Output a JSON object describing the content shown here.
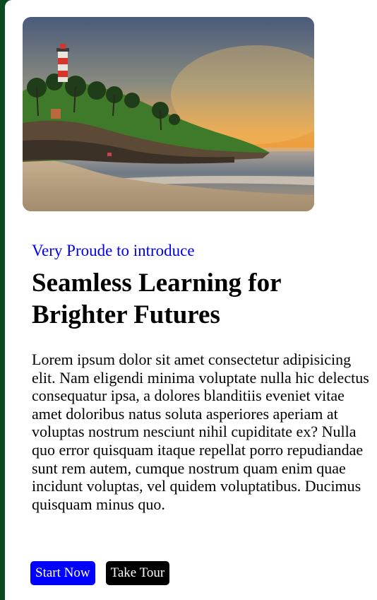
{
  "hero": {
    "image_alt": "Beach at sunset with a lighthouse on a palm-covered hill"
  },
  "intro": {
    "eyebrow": "Very Proude to introduce",
    "title": "Seamless Learning for Brighter Futures",
    "description": "Lorem ipsum dolor sit amet consectetur adipisicing elit. Nam eligendi minima voluptate nulla hic delectus consequatur ipsa, a dolores blanditiis eveniet vitae amet doloribus natus soluta asperiores aperiam at voluptas nostrum nesciunt nihil cupiditate ex? Nulla quo error quisquam itaque repellat porro repudiandae sunt rem autem, cumque nostrum quam enim quae incidunt voluptas, vel quidem voluptatibus. Ducimus quisquam minus quo."
  },
  "actions": {
    "start_label": "Start Now",
    "tour_label": "Take Tour"
  },
  "colors": {
    "page_frame": "#0c4a24",
    "eyebrow": "#0000ee",
    "primary_button": "#0000ff",
    "dark_button": "#000000"
  }
}
